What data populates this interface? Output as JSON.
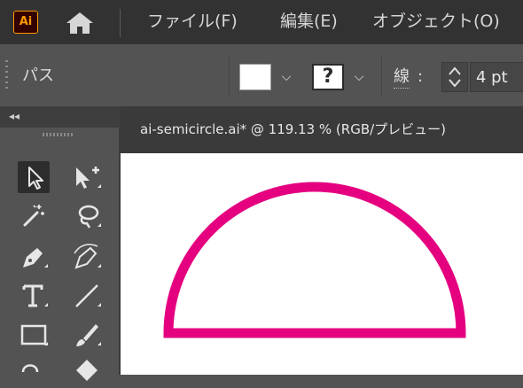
{
  "app": {
    "logo_text": "Ai"
  },
  "menu": {
    "items": [
      "ファイル(F)",
      "編集(E)",
      "オブジェクト(O)"
    ]
  },
  "control_bar": {
    "selection_label": "パス",
    "stroke_label": "線",
    "colon": ":",
    "stroke_weight": "4 pt",
    "fill_color": "#ffffff",
    "stroke_glyph": "?"
  },
  "document": {
    "tab_title": "ai-semicircle.ai* @ 119.13 % (RGB/プレビュー)"
  },
  "artwork": {
    "shape": "semicircle",
    "stroke_color": "#e4007f",
    "fill_color": "#ffffff"
  },
  "colors": {
    "accent": "#ff9a00",
    "ui_dark": "#323232",
    "ui_mid": "#535353"
  }
}
